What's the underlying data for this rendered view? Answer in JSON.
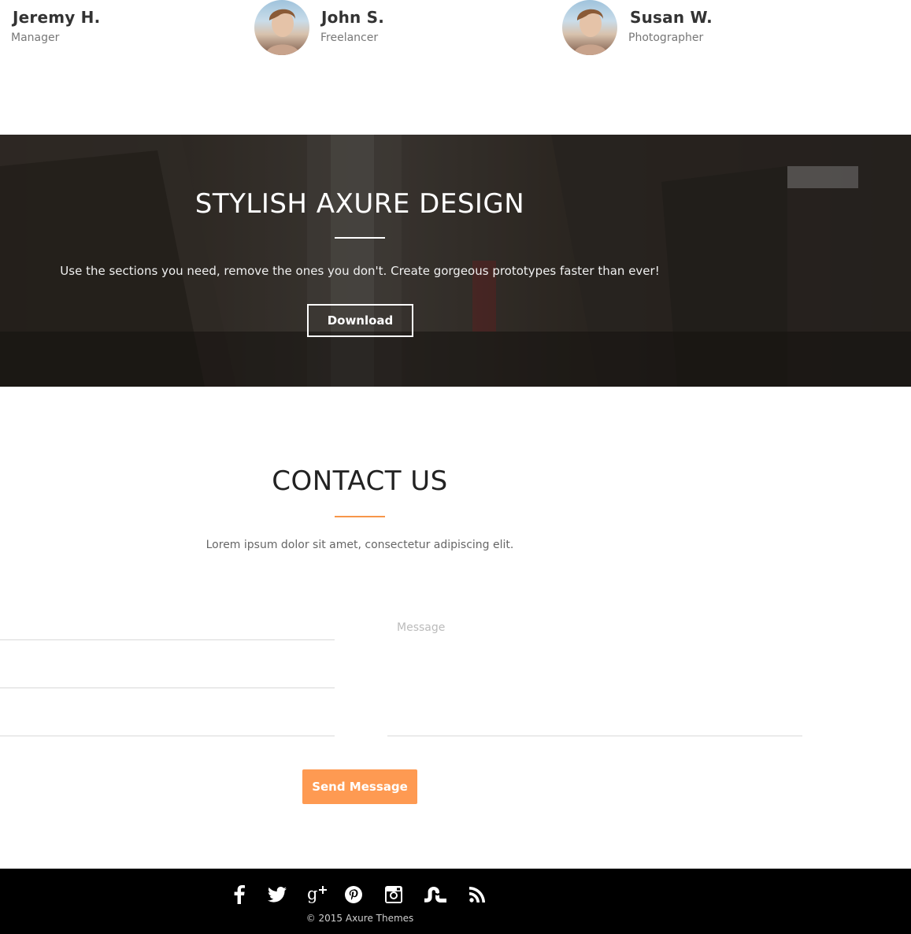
{
  "team": {
    "members": [
      {
        "name": "Jeremy H.",
        "role": "Manager"
      },
      {
        "name": "John S.",
        "role": "Freelancer"
      },
      {
        "name": "Susan W.",
        "role": "Photographer"
      }
    ]
  },
  "hero": {
    "title": "STYLISH AXURE DESIGN",
    "text": "Use the sections you need, remove the ones you don't.  Create gorgeous prototypes faster than ever!",
    "button_label": "Download"
  },
  "contact": {
    "title": "CONTACT US",
    "subtitle": "Lorem ipsum dolor sit amet, consectetur adipiscing elit.",
    "message_placeholder": "Message",
    "send_label": "Send Message"
  },
  "footer": {
    "social_icons": [
      "facebook-icon",
      "twitter-icon",
      "google-plus-icon",
      "pinterest-icon",
      "instagram-icon",
      "stumbleupon-icon",
      "rss-icon"
    ],
    "copyright": "© 2015 Axure Themes"
  },
  "colors": {
    "accent": "#fe9a52",
    "footer_bg": "#000000",
    "hero_overlay": "#3a332c"
  }
}
